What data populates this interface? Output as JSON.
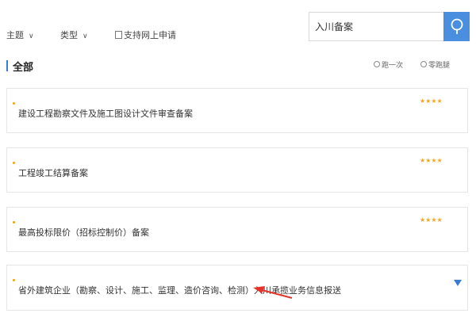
{
  "filters": {
    "topic_label": "主题",
    "type_label": "类型",
    "online_label": "支持网上申请"
  },
  "search": {
    "value": "入川备案",
    "icon": "search-icon",
    "button_color": "#4a8ee0"
  },
  "header": {
    "title": "全部",
    "legend": [
      "跑一次",
      "零跑腿"
    ]
  },
  "services": [
    {
      "title": "建设工程勘察文件及施工图设计文件审查备案",
      "rating": "★★★★"
    },
    {
      "title": "工程竣工结算备案",
      "rating": "★★★★"
    },
    {
      "title": "最高投标限价（招标控制价）备案",
      "rating": "★★★★"
    },
    {
      "title": "省外建筑企业（勘察、设计、施工、监理、造价咨询、检测）入川承揽业务信息报送",
      "rating": ""
    }
  ],
  "colors": {
    "accent": "#3a7bd5",
    "star": "#f5a623",
    "annotation_arrow": "#e5332a"
  }
}
